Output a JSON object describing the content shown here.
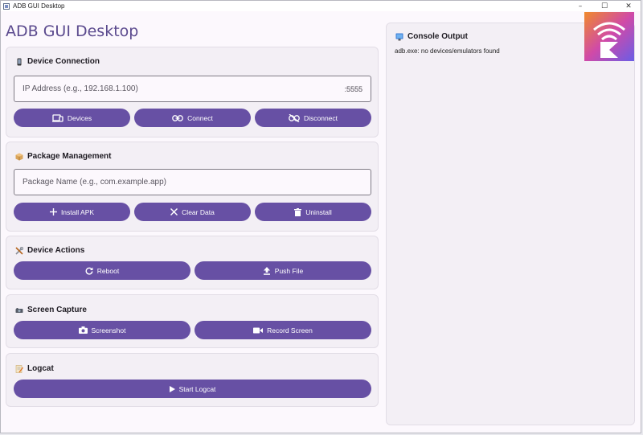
{
  "window": {
    "title": "ADB GUI Desktop"
  },
  "app": {
    "title": "ADB GUI Desktop"
  },
  "device_connection": {
    "header": "Device Connection",
    "ip_placeholder": "IP Address (e.g., 192.168.1.100)",
    "port_suffix": ":5555",
    "buttons": {
      "devices": "Devices",
      "connect": "Connect",
      "disconnect": "Disconnect"
    }
  },
  "package_management": {
    "header": "Package Management",
    "package_placeholder": "Package Name (e.g., com.example.app)",
    "buttons": {
      "install": "Install APK",
      "clear": "Clear Data",
      "uninstall": "Uninstall"
    }
  },
  "device_actions": {
    "header": "Device Actions",
    "buttons": {
      "reboot": "Reboot",
      "push": "Push File"
    }
  },
  "screen_capture": {
    "header": "Screen Capture",
    "buttons": {
      "screenshot": "Screenshot",
      "record": "Record Screen"
    }
  },
  "logcat": {
    "header": "Logcat",
    "buttons": {
      "start": "Start Logcat"
    }
  },
  "console": {
    "header": "Console Output",
    "text": "adb.exe: no devices/emulators found"
  },
  "colors": {
    "accent": "#6750a4",
    "title": "#5b4a8e",
    "card": "#f3eff5",
    "background": "#fcf8fd"
  },
  "icons": {
    "devices": "devices-icon",
    "connect": "link-icon",
    "disconnect": "link-off-icon",
    "install": "plus-icon",
    "clear": "close-icon",
    "uninstall": "trash-icon",
    "reboot": "refresh-icon",
    "push": "upload-icon",
    "screenshot": "camera-icon",
    "record": "video-icon",
    "start": "play-icon"
  }
}
